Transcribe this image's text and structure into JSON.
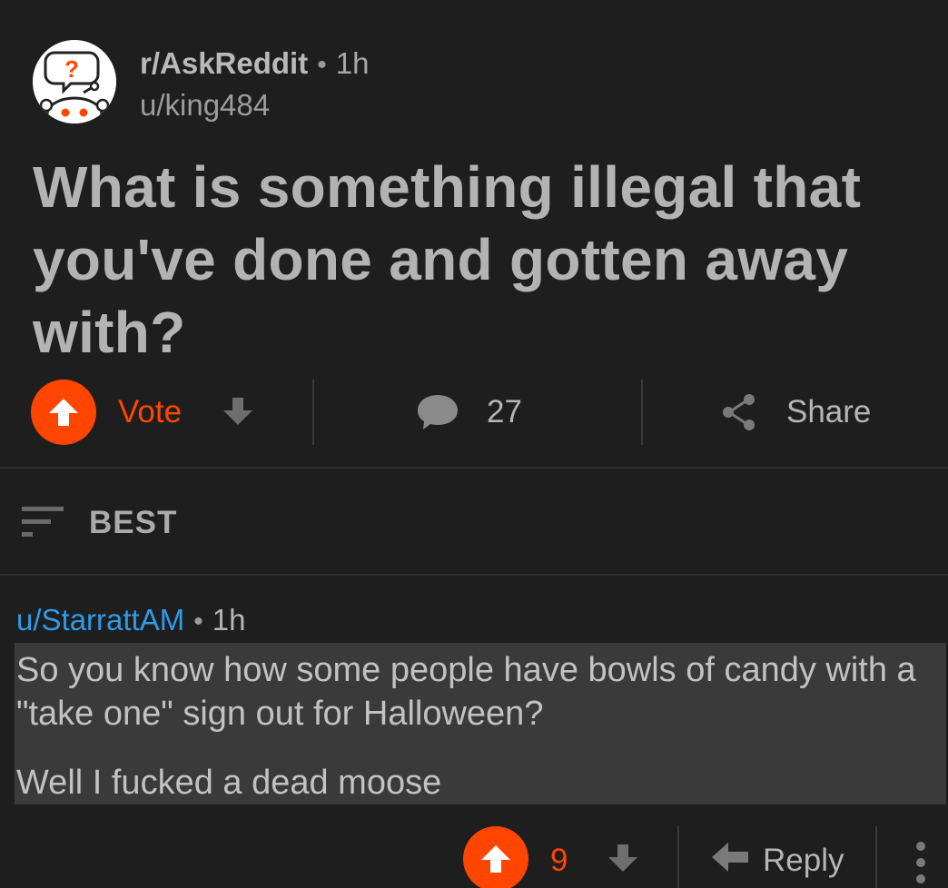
{
  "post": {
    "subreddit": "r/AskReddit",
    "separator": "•",
    "age": "1h",
    "author": "u/king484",
    "title": "What is something illegal that you've done and gotten away with?",
    "vote_label": "Vote",
    "comment_count": "27",
    "share_label": "Share"
  },
  "sort": {
    "label": "BEST"
  },
  "comment": {
    "author": "u/StarrattAM",
    "separator": "•",
    "age": "1h",
    "paragraphs": [
      "So you know how some people have bowls of candy with a \"take one\" sign out for Halloween?",
      "Well I fucked a dead moose"
    ],
    "score": "9",
    "reply_label": "Reply"
  },
  "icons": {
    "avatar": "askreddit-snoo-icon",
    "upvote": "upvote-arrow-icon",
    "downvote": "downvote-arrow-icon",
    "comment": "comment-bubble-icon",
    "share": "share-icon",
    "sort": "sort-lines-icon",
    "reply": "reply-arrow-icon",
    "more": "more-vertical-icon"
  },
  "colors": {
    "background": "#1e1e1e",
    "accent": "#ff4500",
    "link": "#2f9ae8",
    "highlight": "#3a3a3a"
  }
}
